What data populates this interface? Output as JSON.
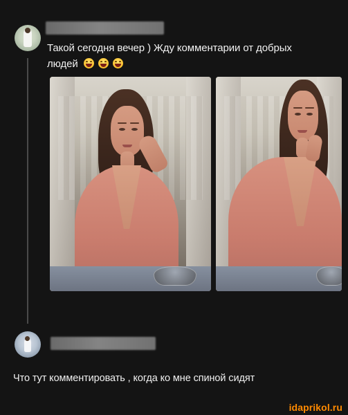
{
  "post": {
    "text_line_1": "Такой сегодня вечер ) Жду комментарии от добрых",
    "text_line_2": "людей"
  },
  "comment": {
    "text": "Что тут комментировать , когда ко мне спиной сидят"
  },
  "watermark": {
    "text": "idaprikol.ru"
  },
  "colors": {
    "background": "#141414",
    "text": "#f1f1f1",
    "thread_line": "#4a4a4a",
    "watermark": "#ff8a00",
    "dress": "#d7917f"
  },
  "icons": {
    "reaction_emoji": "laughing-face-icon"
  }
}
